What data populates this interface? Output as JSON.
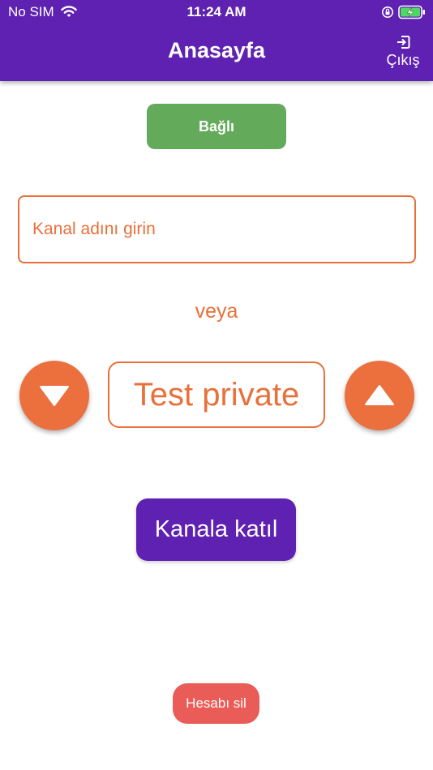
{
  "status_bar": {
    "carrier": "No SIM",
    "time": "11:24 AM"
  },
  "app_bar": {
    "title": "Anasayfa",
    "logout_label": "Çıkış",
    "background_color": "#5e21b1"
  },
  "connection": {
    "status_label": "Bağlı",
    "status_color": "#63aa5a"
  },
  "channel_input": {
    "placeholder": "Kanal adını girin"
  },
  "or_label": "veya",
  "channel_selector": {
    "current_channel": "Test private",
    "accent_color": "#e8703a"
  },
  "join_button": {
    "label": "Kanala katıl"
  },
  "delete_account": {
    "label": "Hesabı sil",
    "color": "#ea5c57"
  }
}
